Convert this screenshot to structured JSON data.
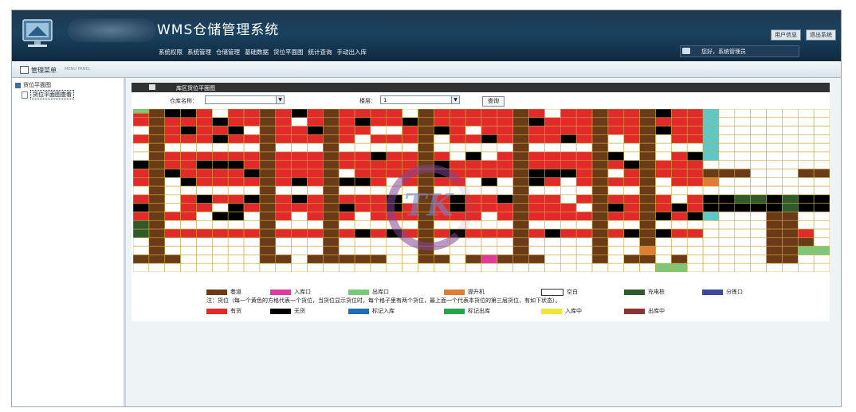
{
  "header": {
    "app_title": "WMS仓储管理系统",
    "user_info_label": "用户信息",
    "logout_label": "退出系统",
    "welcome": "您好，系统管理员"
  },
  "menu": [
    {
      "label": "系统权限"
    },
    {
      "label": "系统管理"
    },
    {
      "label": "仓储管理"
    },
    {
      "label": "基础数据"
    },
    {
      "label": "货位平面图"
    },
    {
      "label": "统计查询"
    },
    {
      "label": "手动出入库"
    }
  ],
  "subbar": {
    "title": "管理菜单",
    "sub": "MENU PANEL"
  },
  "sidebar": {
    "root": "货位平面图",
    "child": "货位平面图查看"
  },
  "pane": {
    "title": "库区货位平面图",
    "warehouse_label": "仓库名称：",
    "warehouse_value": "",
    "floor_label": "楼层：",
    "floor_value": "1",
    "query_label": "查询"
  },
  "legend": {
    "row1": [
      {
        "label": "巷道",
        "color": "#6b3a17"
      },
      {
        "label": "入库口",
        "color": "#e23a9a"
      },
      {
        "label": "出库口",
        "color": "#7cc87a"
      },
      {
        "label": "提升机",
        "color": "#e07c35"
      },
      {
        "label": "空白",
        "color": "#ffffff"
      },
      {
        "label": "充电桩",
        "color": "#2f5a2c"
      },
      {
        "label": "分拣口",
        "color": "#3b4aa0"
      }
    ],
    "note": "注：货位（每一个黄色的方格代表一个货位，当货位显示货位时，每个格子里有两个货位，最上面一个代表本货位的第三层货位，有如下状态）。",
    "row2": [
      {
        "label": "有货",
        "color": "#e22a2a"
      },
      {
        "label": "无货",
        "color": "#000000"
      },
      {
        "label": "标记入库",
        "color": "#1f6fb3"
      },
      {
        "label": "标记出库",
        "color": "#29a34a"
      },
      {
        "label": "入库中",
        "color": "#f0e43a"
      },
      {
        "label": "出库中",
        "color": "#8b3434"
      }
    ]
  },
  "grid": {
    "cols": 44,
    "rows": 19,
    "colors": {
      "aisle": "#6b3a17",
      "occupied": "#e22a2a",
      "empty": "#000000",
      "blank": "#ffffff",
      "cyan": "#5ec8c8",
      "green": "#7cc87a",
      "orange": "#e07c35",
      "pink": "#e23a9a",
      "darkgreen": "#2f5a2c",
      "border": "#c9a93a"
    }
  },
  "watermark": {
    "text": "TK"
  }
}
